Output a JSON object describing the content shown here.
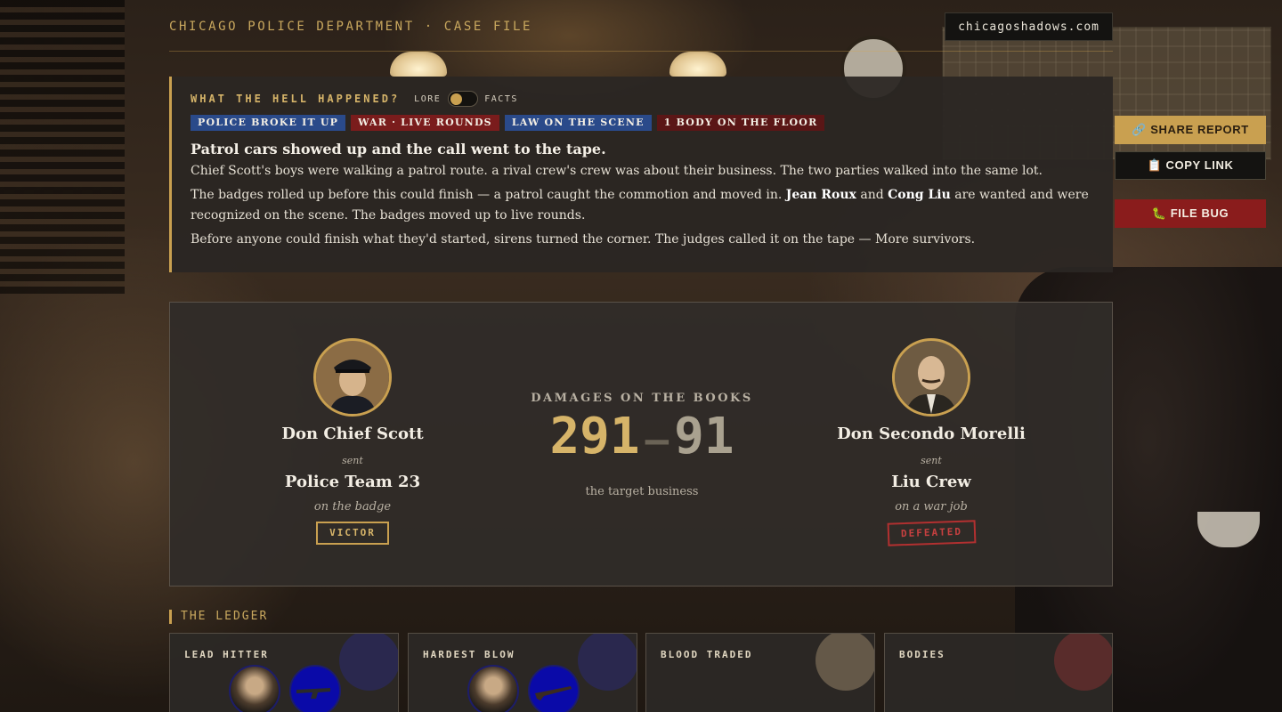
{
  "header": {
    "department": "CHICAGO POLICE DEPARTMENT · CASE FILE",
    "site": "chicagoshadows.com"
  },
  "report": {
    "question": "WHAT THE HELL HAPPENED?",
    "toggle_left": "LORE",
    "toggle_right": "FACTS",
    "toggle_state": "lore",
    "tags": [
      "POLICE BROKE IT UP",
      "WAR · LIVE ROUNDS",
      "LAW ON THE SCENE",
      "1 BODY ON THE FLOOR"
    ],
    "headline": "Patrol cars showed up and the call went to the tape.",
    "p1": "Chief Scott's boys were walking a patrol route. a rival crew's crew was about their business. The two parties walked into the same lot.",
    "p2a": "The badges rolled up before this could finish — a patrol caught the commotion and moved in.",
    "name1": "Jean Roux",
    "p2b": "and",
    "name2": "Cong Liu",
    "p2c": "are wanted and were recognized on the scene. The badges moved up to live rounds.",
    "p3": "Before anyone could finish what they'd started, sirens turned the corner. The judges called it on the tape — More survivors."
  },
  "actions": {
    "share": "🔗 SHARE REPORT",
    "copy": "📋 COPY LINK",
    "bug": "🐛 FILE BUG"
  },
  "versus": {
    "left": {
      "don": "Don Chief Scott",
      "sent": "sent",
      "crew": "Police Team 23",
      "role": "on the badge",
      "result": "VICTOR"
    },
    "center": {
      "label": "DAMAGES ON THE BOOKS",
      "score_left": "291",
      "dash": "—",
      "score_right": "91",
      "target": "the target business"
    },
    "right": {
      "don": "Don Secondo Morelli",
      "sent": "sent",
      "crew": "Liu Crew",
      "role": "on a war job",
      "result": "DEFEATED"
    }
  },
  "ledger": {
    "title": "THE LEDGER",
    "cards": [
      {
        "label": "LEAD HITTER",
        "accent": "#2a2a6a"
      },
      {
        "label": "HARDEST BLOW",
        "accent": "#2a2a6a"
      },
      {
        "label": "BLOOD TRADED",
        "accent": "#8a7a60"
      },
      {
        "label": "BODIES",
        "accent": "#7a3030"
      }
    ]
  },
  "colors": {
    "gold": "#c9a050",
    "blue_tag": "#2a4a8a",
    "red_tag": "#7a1c1c",
    "defeated": "#c84040"
  }
}
